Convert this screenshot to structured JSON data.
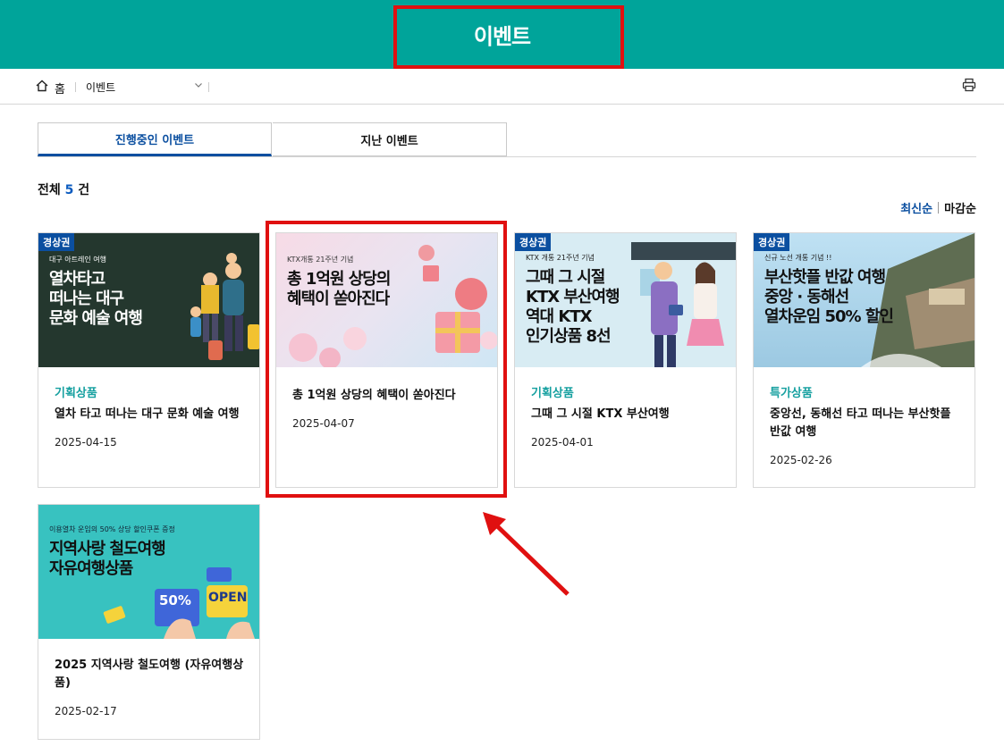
{
  "header": {
    "title": "이벤트"
  },
  "breadcrumb": {
    "home": "홈",
    "current": "이벤트"
  },
  "tabs": [
    {
      "label": "진행중인 이벤트",
      "active": true
    },
    {
      "label": "지난 이벤트",
      "active": false
    }
  ],
  "total": {
    "prefix": "전체",
    "count": "5",
    "suffix": "건"
  },
  "sort": {
    "latest": "최신순",
    "deadline": "마감순"
  },
  "events": [
    {
      "badge": "경상권",
      "thumb_sub": "대구 아트레인 여행",
      "thumb_main": [
        "열차타고",
        "떠나는 대구",
        "문화 예술 여행"
      ],
      "category": "기획상품",
      "title": "열차 타고 떠나는 대구 문화 예술 여행",
      "date": "2025-04-15"
    },
    {
      "badge": "",
      "thumb_sub": "KTX개통 21주년 기념",
      "thumb_main": [
        "총 1억원 상당의",
        "혜택이 쏟아진다"
      ],
      "category": "",
      "title": "총 1억원 상당의 혜택이 쏟아진다",
      "date": "2025-04-07"
    },
    {
      "badge": "경상권",
      "thumb_sub": "KTX 개통 21주년 기념",
      "thumb_main": [
        "그때 그 시절",
        "KTX 부산여행",
        "역대 KTX",
        "인기상품 8선"
      ],
      "category": "기획상품",
      "title": "그때 그 시절 KTX 부산여행",
      "date": "2025-04-01"
    },
    {
      "badge": "경상권",
      "thumb_sub": "신규 노선 개통 기념 !!",
      "thumb_main": [
        "부산핫플 반값 여행",
        "중앙 · 동해선",
        "열차운임 50% 할인"
      ],
      "category": "특가상품",
      "title": "중앙선, 동해선 타고 떠나는 부산핫플 반값 여행",
      "date": "2025-02-26"
    },
    {
      "badge": "",
      "thumb_sub": "이용열차 운임의 50% 상당 할인쿠폰 증정",
      "thumb_main": [
        "지역사랑 철도여행",
        "자유여행상품"
      ],
      "thumb_coupon": [
        "50%",
        "OPEN"
      ],
      "category": "",
      "title": "2025 지역사랑 철도여행 (자유여행상품)",
      "date": "2025-02-17"
    }
  ],
  "colors": {
    "header": "#00a49a",
    "accent": "#0b4fa0",
    "category": "#16a0a0",
    "highlight": "#e01010"
  }
}
